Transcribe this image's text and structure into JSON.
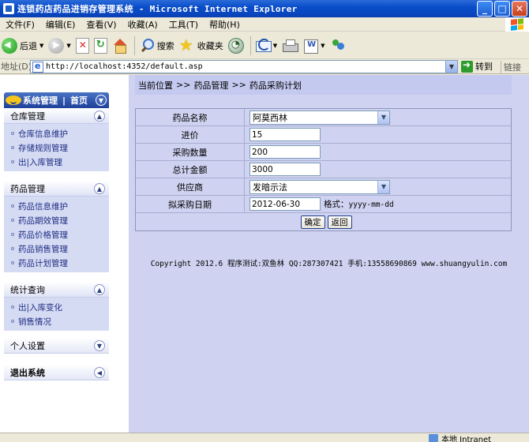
{
  "window": {
    "title": "连锁药店药品进销存管理系统 - Microsoft Internet Explorer",
    "minimize": "_",
    "maximize": "□",
    "close": "✕"
  },
  "menu": {
    "items": [
      "文件(F)",
      "编辑(E)",
      "查看(V)",
      "收藏(A)",
      "工具(T)",
      "帮助(H)"
    ]
  },
  "toolbar": {
    "back_label": "后退",
    "search_label": "搜索",
    "favorites_label": "收藏夹"
  },
  "address": {
    "label": "地址(D)",
    "url": "http://localhost:4352/default.asp",
    "go_label": "转到",
    "links_label": "链接"
  },
  "sidebar": {
    "title": "系统管理",
    "divider": "|",
    "home": "首页",
    "groups": [
      {
        "title": "仓库管理",
        "items": [
          "仓库信息维护",
          "存储规则管理",
          "出|入库管理"
        ]
      },
      {
        "title": "药品管理",
        "items": [
          "药品信息维护",
          "药品期效管理",
          "药品价格管理",
          "药品销售管理",
          "药品计划管理"
        ]
      },
      {
        "title": "统计查询",
        "items": [
          "出|入库变化",
          "销售情况"
        ]
      },
      {
        "title": "个人设置",
        "items": []
      },
      {
        "title": "退出系统",
        "items": []
      }
    ]
  },
  "breadcrumb": {
    "current": "当前位置",
    "sep": ">>",
    "level1": "药品管理",
    "level2": "药品采购计划"
  },
  "form": {
    "drug_name_label": "药品名称",
    "drug_name_value": "阿莫西林",
    "price_label": "进价",
    "price_value": "15",
    "qty_label": "采购数量",
    "qty_value": "200",
    "total_label": "总计金额",
    "total_value": "3000",
    "supplier_label": "供应商",
    "supplier_value": "发暗示法",
    "date_label": "拟采购日期",
    "date_value": "2012-06-30",
    "date_format_label": "格式：",
    "date_format": "yyyy-mm-dd",
    "confirm_label": "确定",
    "back_label": "返回"
  },
  "footer": {
    "text": "Copyright 2012.6 程序测试:双鱼林 QQ:287307421 手机:13558690869 www.shuangyulin.com"
  },
  "status": {
    "zone": "本地 Intranet"
  }
}
